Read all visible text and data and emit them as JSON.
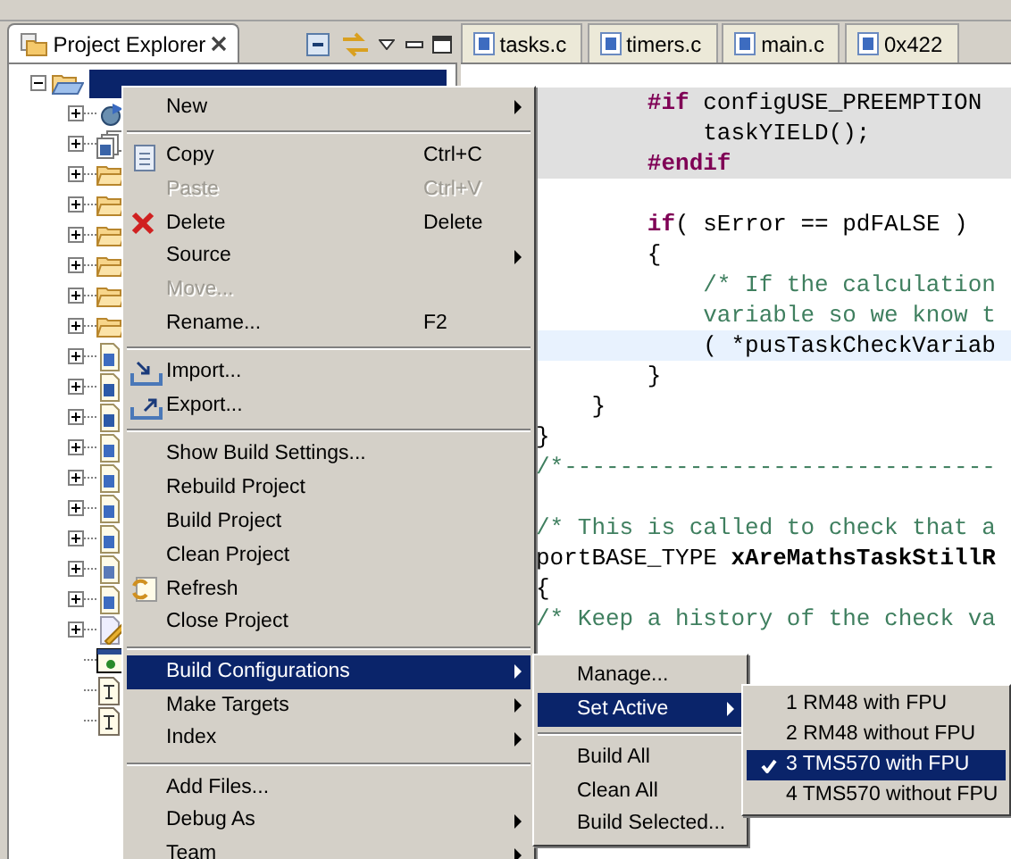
{
  "explorer": {
    "title": "Project Explorer",
    "project": {
      "expanded": true,
      "selected": true,
      "children": [
        {
          "kind": "binaries",
          "expandable": true
        },
        {
          "kind": "includes",
          "expandable": true
        },
        {
          "kind": "folder",
          "expandable": true
        },
        {
          "kind": "folder",
          "expandable": true
        },
        {
          "kind": "folder",
          "expandable": true
        },
        {
          "kind": "folder",
          "expandable": true
        },
        {
          "kind": "folder",
          "expandable": true
        },
        {
          "kind": "folder",
          "expandable": true
        },
        {
          "kind": "c-file",
          "expandable": true
        },
        {
          "kind": "h-file",
          "expandable": true
        },
        {
          "kind": "h-file",
          "expandable": true
        },
        {
          "kind": "c-file",
          "expandable": true
        },
        {
          "kind": "c-file",
          "expandable": true
        },
        {
          "kind": "c-file",
          "expandable": true
        },
        {
          "kind": "c-file",
          "expandable": true
        },
        {
          "kind": "s-file",
          "expandable": true
        },
        {
          "kind": "c-file",
          "expandable": true
        },
        {
          "kind": "linker-file",
          "expandable": true
        },
        {
          "kind": "target-config",
          "expandable": false
        },
        {
          "kind": "document",
          "expandable": false
        },
        {
          "kind": "document",
          "expandable": false
        }
      ]
    }
  },
  "editor": {
    "tabs": [
      {
        "label": "tasks.c",
        "selected": false
      },
      {
        "label": "timers.c",
        "selected": false
      },
      {
        "label": "main.c",
        "selected": false
      },
      {
        "label": "0x422",
        "selected": false
      }
    ],
    "lines": [
      {
        "inactive": true,
        "segments": [
          {
            "kind": "keyword",
            "text": "        #if"
          },
          {
            "kind": "plain",
            "text": " configUSE_PREEMPTION"
          }
        ]
      },
      {
        "inactive": true,
        "segments": [
          {
            "kind": "plain",
            "text": "            taskYIELD();"
          }
        ]
      },
      {
        "inactive": true,
        "segments": [
          {
            "kind": "keyword",
            "text": "        #endif"
          }
        ]
      },
      {
        "gap_before": true,
        "segments": [
          {
            "kind": "keyword",
            "text": "        if"
          },
          {
            "kind": "plain",
            "text": "( sError == pdFALSE )"
          }
        ]
      },
      {
        "segments": [
          {
            "kind": "plain",
            "text": "        {"
          }
        ]
      },
      {
        "segments": [
          {
            "kind": "comment",
            "text": "            /* If the calculation"
          }
        ]
      },
      {
        "segments": [
          {
            "kind": "comment",
            "text": "            variable so we know t"
          }
        ]
      },
      {
        "current": true,
        "segments": [
          {
            "kind": "plain",
            "text": "            ( *pusTaskCheckVariab"
          }
        ]
      },
      {
        "segments": [
          {
            "kind": "plain",
            "text": "        }"
          }
        ]
      },
      {
        "segments": [
          {
            "kind": "plain",
            "text": "    }"
          }
        ]
      },
      {
        "segments": [
          {
            "kind": "plain",
            "text": "}"
          }
        ]
      },
      {
        "segments": [
          {
            "kind": "comment",
            "text": "/*-------------------------------"
          }
        ]
      },
      {
        "gap_before": true,
        "segments": [
          {
            "kind": "comment",
            "text": "/* This is called to check that a"
          }
        ]
      },
      {
        "segments": [
          {
            "kind": "plain",
            "text": "portBASE_TYPE "
          },
          {
            "kind": "bold",
            "text": "xAreMathsTaskStillR"
          }
        ]
      },
      {
        "segments": [
          {
            "kind": "plain",
            "text": "{"
          }
        ]
      },
      {
        "segments": [
          {
            "kind": "comment",
            "text": "/* Keep a history of the check va"
          }
        ]
      }
    ]
  },
  "context_menu": [
    {
      "kind": "item",
      "label": "New",
      "submenu": true,
      "disabled": false,
      "selected": false
    },
    {
      "kind": "separator"
    },
    {
      "kind": "copy",
      "label": "Copy",
      "shortcut": "Ctrl+C",
      "disabled": false,
      "selected": false
    },
    {
      "kind": "item",
      "label": "Paste",
      "shortcut": "Ctrl+V",
      "disabled": true,
      "selected": false
    },
    {
      "kind": "delete",
      "label": "Delete",
      "shortcut": "Delete",
      "disabled": false,
      "selected": false
    },
    {
      "kind": "item",
      "label": "Source",
      "submenu": true,
      "disabled": false,
      "selected": false
    },
    {
      "kind": "item",
      "label": "Move...",
      "disabled": true,
      "selected": false
    },
    {
      "kind": "item",
      "label": "Rename...",
      "shortcut": "F2",
      "disabled": false,
      "selected": false
    },
    {
      "kind": "separator"
    },
    {
      "kind": "import",
      "label": "Import...",
      "disabled": false,
      "selected": false
    },
    {
      "kind": "export",
      "label": "Export...",
      "disabled": false,
      "selected": false
    },
    {
      "kind": "separator"
    },
    {
      "kind": "item",
      "label": "Show Build Settings...",
      "disabled": false,
      "selected": false
    },
    {
      "kind": "item",
      "label": "Rebuild Project",
      "disabled": false,
      "selected": false
    },
    {
      "kind": "item",
      "label": "Build Project",
      "disabled": false,
      "selected": false
    },
    {
      "kind": "item",
      "label": "Clean Project",
      "disabled": false,
      "selected": false
    },
    {
      "kind": "refresh",
      "label": "Refresh",
      "disabled": false,
      "selected": false
    },
    {
      "kind": "item",
      "label": "Close Project",
      "disabled": false,
      "selected": false
    },
    {
      "kind": "separator"
    },
    {
      "kind": "item",
      "label": "Build Configurations",
      "submenu": true,
      "disabled": false,
      "selected": true
    },
    {
      "kind": "item",
      "label": "Make Targets",
      "submenu": true,
      "disabled": false,
      "selected": false
    },
    {
      "kind": "item",
      "label": "Index",
      "submenu": true,
      "disabled": false,
      "selected": false
    },
    {
      "kind": "separator"
    },
    {
      "kind": "item",
      "label": "Add Files...",
      "disabled": false,
      "selected": false
    },
    {
      "kind": "item",
      "label": "Debug As",
      "submenu": true,
      "disabled": false,
      "selected": false
    },
    {
      "kind": "item",
      "label": "Team",
      "submenu": true,
      "disabled": false,
      "selected": false
    }
  ],
  "build_configurations_menu": [
    {
      "kind": "item",
      "label": "Manage...",
      "selected": false
    },
    {
      "kind": "item",
      "label": "Set Active",
      "submenu": true,
      "selected": true
    },
    {
      "kind": "separator"
    },
    {
      "kind": "item",
      "label": "Build All",
      "selected": false
    },
    {
      "kind": "item",
      "label": "Clean All",
      "selected": false
    },
    {
      "kind": "item",
      "label": "Build Selected...",
      "selected": false
    }
  ],
  "set_active_menu": [
    {
      "label": "1 RM48 with FPU",
      "checked": false,
      "selected": false
    },
    {
      "label": "2 RM48 without FPU",
      "checked": false,
      "selected": false
    },
    {
      "label": "3 TMS570 with FPU",
      "checked": true,
      "selected": true
    },
    {
      "label": "4 TMS570 without FPU",
      "checked": false,
      "selected": false
    }
  ]
}
